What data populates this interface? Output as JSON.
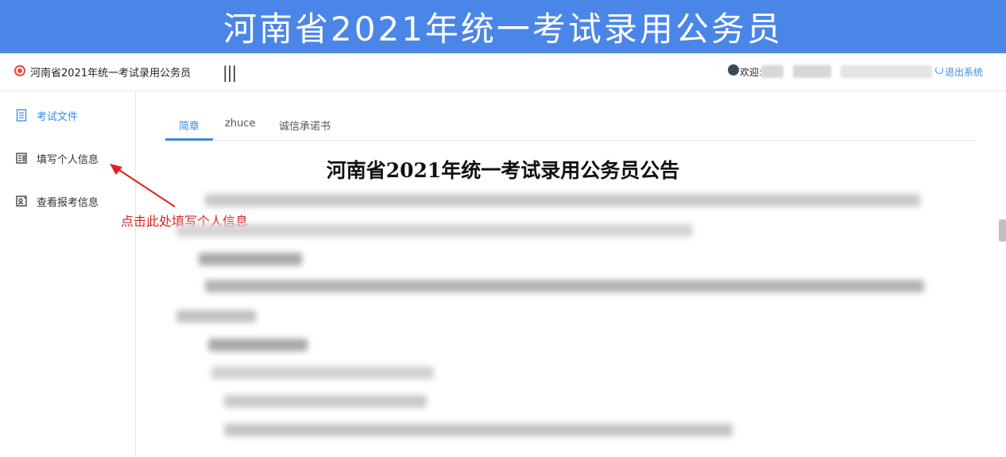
{
  "banner": {
    "title": "河南省2021年统一考试录用公务员"
  },
  "header": {
    "site_name": "河南省2021年统一考试录用公务员",
    "menu_toggle": "|||",
    "welcome_label": "欢迎:",
    "logout_label": "退出系统"
  },
  "sidebar": {
    "items": [
      {
        "label": "考试文件",
        "icon": "document-icon"
      },
      {
        "label": "填写个人信息",
        "icon": "id-card-icon"
      },
      {
        "label": "查看报考信息",
        "icon": "profile-search-icon"
      }
    ]
  },
  "annotation": {
    "text": "点击此处填写个人信息"
  },
  "tabs": [
    {
      "label": "简章",
      "active": true
    },
    {
      "label": "zhuce",
      "active": false
    },
    {
      "label": "诚信承诺书",
      "active": false
    }
  ],
  "notice": {
    "title": "河南省2021年统一考试录用公务员公告"
  },
  "colors": {
    "banner": "#4a86e8",
    "accent": "#3b8be0",
    "annotation": "#e02020",
    "logo": "#e64a3c"
  }
}
